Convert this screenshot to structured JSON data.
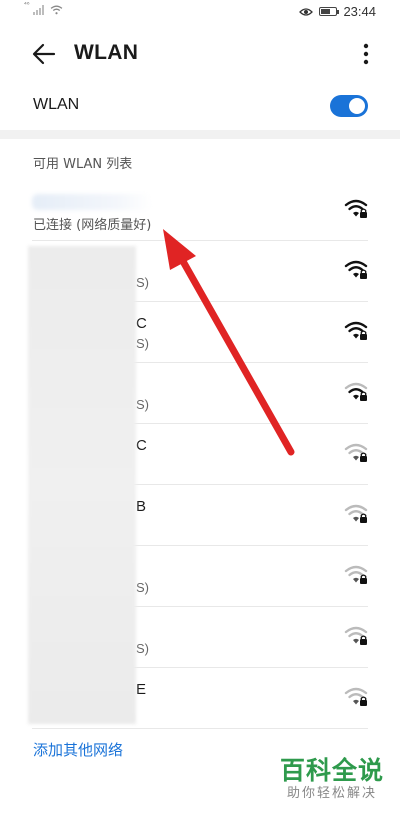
{
  "status_bar": {
    "signal_label": "⁴⁶",
    "time": "23:44"
  },
  "app_bar": {
    "title": "WLAN"
  },
  "wlan_toggle": {
    "label": "WLAN",
    "enabled": true,
    "accent_color": "#1a73d8"
  },
  "section": {
    "header": "可用 WLAN 列表"
  },
  "networks": [
    {
      "name": "",
      "status": "已连接 (网络质量好)",
      "connected": true,
      "signal": "strong"
    },
    {
      "name": "",
      "status": "S)",
      "signal": "strong"
    },
    {
      "name": "C",
      "status": "S)",
      "signal": "strong"
    },
    {
      "name": "",
      "status": "S)",
      "signal": "medium"
    },
    {
      "name": "C",
      "status": "",
      "signal": "weak"
    },
    {
      "name": "B",
      "status": "",
      "signal": "weak"
    },
    {
      "name": "",
      "status": "S)",
      "signal": "weak"
    },
    {
      "name": "",
      "status": "S)",
      "signal": "weak"
    },
    {
      "name": "E",
      "status": "",
      "signal": "weak"
    }
  ],
  "add_network": {
    "label": "添加其他网络"
  },
  "watermark": {
    "title": "百科全说",
    "subtitle": "助你轻松解决"
  },
  "annotation": {
    "arrow_color": "#e02424"
  }
}
